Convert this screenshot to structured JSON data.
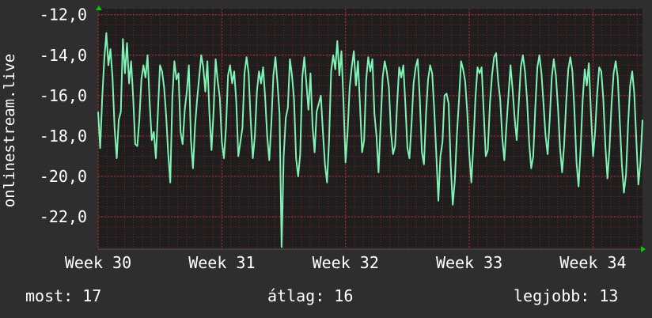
{
  "chart_data": {
    "type": "line",
    "ylabel": "onlinestream.live",
    "ylim": [
      -23.6,
      -11.7
    ],
    "y_ticks": [
      -12,
      -14,
      -16,
      -18,
      -20,
      -22
    ],
    "y_tick_labels": [
      "-12,0",
      "-14,0",
      "-16,0",
      "-18,0",
      "-20,0",
      "-22,0"
    ],
    "x_ticks": [
      0,
      1,
      2,
      3,
      4
    ],
    "x_tick_labels": [
      "Week 30",
      "Week 31",
      "Week 32",
      "Week 33",
      "Week 34"
    ],
    "xlim": [
      0,
      4.4
    ],
    "grid": true,
    "colors": {
      "background": "#2e2e2e",
      "plot_bg": "#1e1e1e",
      "grid": "#7a2020",
      "line": "#7ff2b5",
      "axis": "#555555",
      "arrow": "#00cc00"
    },
    "series": [
      {
        "values": [
          -16.8,
          -18.6,
          -16.1,
          -14.2,
          -12.9,
          -14.5,
          -13.7,
          -15.1,
          -17.6,
          -19.1,
          -17.2,
          -16.8,
          -13.2,
          -14.9,
          -13.4,
          -15.4,
          -14.3,
          -16.1,
          -18.4,
          -18.5,
          -17.2,
          -15.2,
          -14.5,
          -15.1,
          -14.0,
          -16.4,
          -18.2,
          -17.8,
          -19.1,
          -16.8,
          -14.5,
          -14.8,
          -15.6,
          -17.0,
          -18.9,
          -20.3,
          -16.1,
          -14.3,
          -15.2,
          -14.9,
          -17.8,
          -18.4,
          -16.7,
          -15.8,
          -14.5,
          -18.2,
          -19.6,
          -17.5,
          -16.2,
          -15.1,
          -14.0,
          -14.6,
          -15.8,
          -14.3,
          -16.9,
          -18.7,
          -16.8,
          -14.2,
          -15.3,
          -16.1,
          -18.3,
          -19.1,
          -17.6,
          -15.0,
          -14.5,
          -15.4,
          -14.8,
          -16.3,
          -19.0,
          -18.3,
          -17.6,
          -14.9,
          -14.1,
          -14.9,
          -17.2,
          -19.1,
          -18.0,
          -15.8,
          -14.8,
          -15.4,
          -14.6,
          -16.1,
          -18.0,
          -19.2,
          -17.4,
          -15.0,
          -14.1,
          -15.4,
          -16.9,
          -23.5,
          -19.0,
          -17.1,
          -16.6,
          -14.2,
          -15.0,
          -16.2,
          -19.1,
          -20.0,
          -18.9,
          -15.1,
          -14.1,
          -15.4,
          -16.7,
          -14.9,
          -17.5,
          -18.8,
          -16.8,
          -16.4,
          -16.0,
          -17.8,
          -19.4,
          -20.3,
          -18.2,
          -14.8,
          -14.0,
          -14.7,
          -13.3,
          -15.0,
          -13.8,
          -16.3,
          -19.3,
          -17.8,
          -15.6,
          -14.6,
          -13.8,
          -15.5,
          -14.3,
          -16.5,
          -18.8,
          -18.2,
          -15.2,
          -14.1,
          -14.8,
          -14.2,
          -16.9,
          -18.0,
          -19.8,
          -17.4,
          -15.1,
          -14.3,
          -14.8,
          -15.6,
          -17.8,
          -18.9,
          -18.5,
          -16.4,
          -14.6,
          -15.1,
          -14.5,
          -16.4,
          -18.6,
          -19.1,
          -17.4,
          -15.4,
          -14.6,
          -14.2,
          -16.1,
          -18.8,
          -19.4,
          -16.9,
          -15.2,
          -14.5,
          -14.9,
          -16.7,
          -18.9,
          -21.2,
          -19.0,
          -18.3,
          -16.0,
          -15.9,
          -16.4,
          -19.4,
          -21.4,
          -20.2,
          -17.9,
          -16.2,
          -14.3,
          -14.7,
          -15.3,
          -16.8,
          -18.9,
          -20.3,
          -18.4,
          -16.1,
          -14.6,
          -14.9,
          -14.6,
          -16.8,
          -19.0,
          -18.7,
          -16.4,
          -15.0,
          -14.1,
          -13.9,
          -15.3,
          -16.2,
          -18.1,
          -19.2,
          -17.5,
          -16.0,
          -14.5,
          -15.7,
          -17.1,
          -18.2,
          -16.4,
          -14.6,
          -14.0,
          -14.8,
          -16.2,
          -18.3,
          -19.6,
          -19.0,
          -16.6,
          -14.6,
          -14.0,
          -14.9,
          -16.4,
          -18.0,
          -18.9,
          -17.2,
          -15.1,
          -14.2,
          -15.0,
          -16.6,
          -18.6,
          -19.8,
          -18.4,
          -16.3,
          -14.7,
          -14.1,
          -14.8,
          -16.8,
          -19.3,
          -20.5,
          -18.6,
          -16.2,
          -14.7,
          -15.5,
          -14.4,
          -16.8,
          -19.0,
          -17.8,
          -15.9,
          -14.6,
          -14.8,
          -16.2,
          -18.5,
          -20.1,
          -18.6,
          -16.4,
          -14.9,
          -14.3,
          -15.1,
          -17.3,
          -19.4,
          -20.8,
          -19.9,
          -17.4,
          -15.5,
          -14.8,
          -15.9,
          -18.2,
          -20.4,
          -19.3,
          -17.2
        ]
      }
    ]
  },
  "stats": [
    {
      "label": "most:",
      "value": "17"
    },
    {
      "label": "átlag:",
      "value": "16"
    },
    {
      "label": "legjobb:",
      "value": "13"
    }
  ]
}
